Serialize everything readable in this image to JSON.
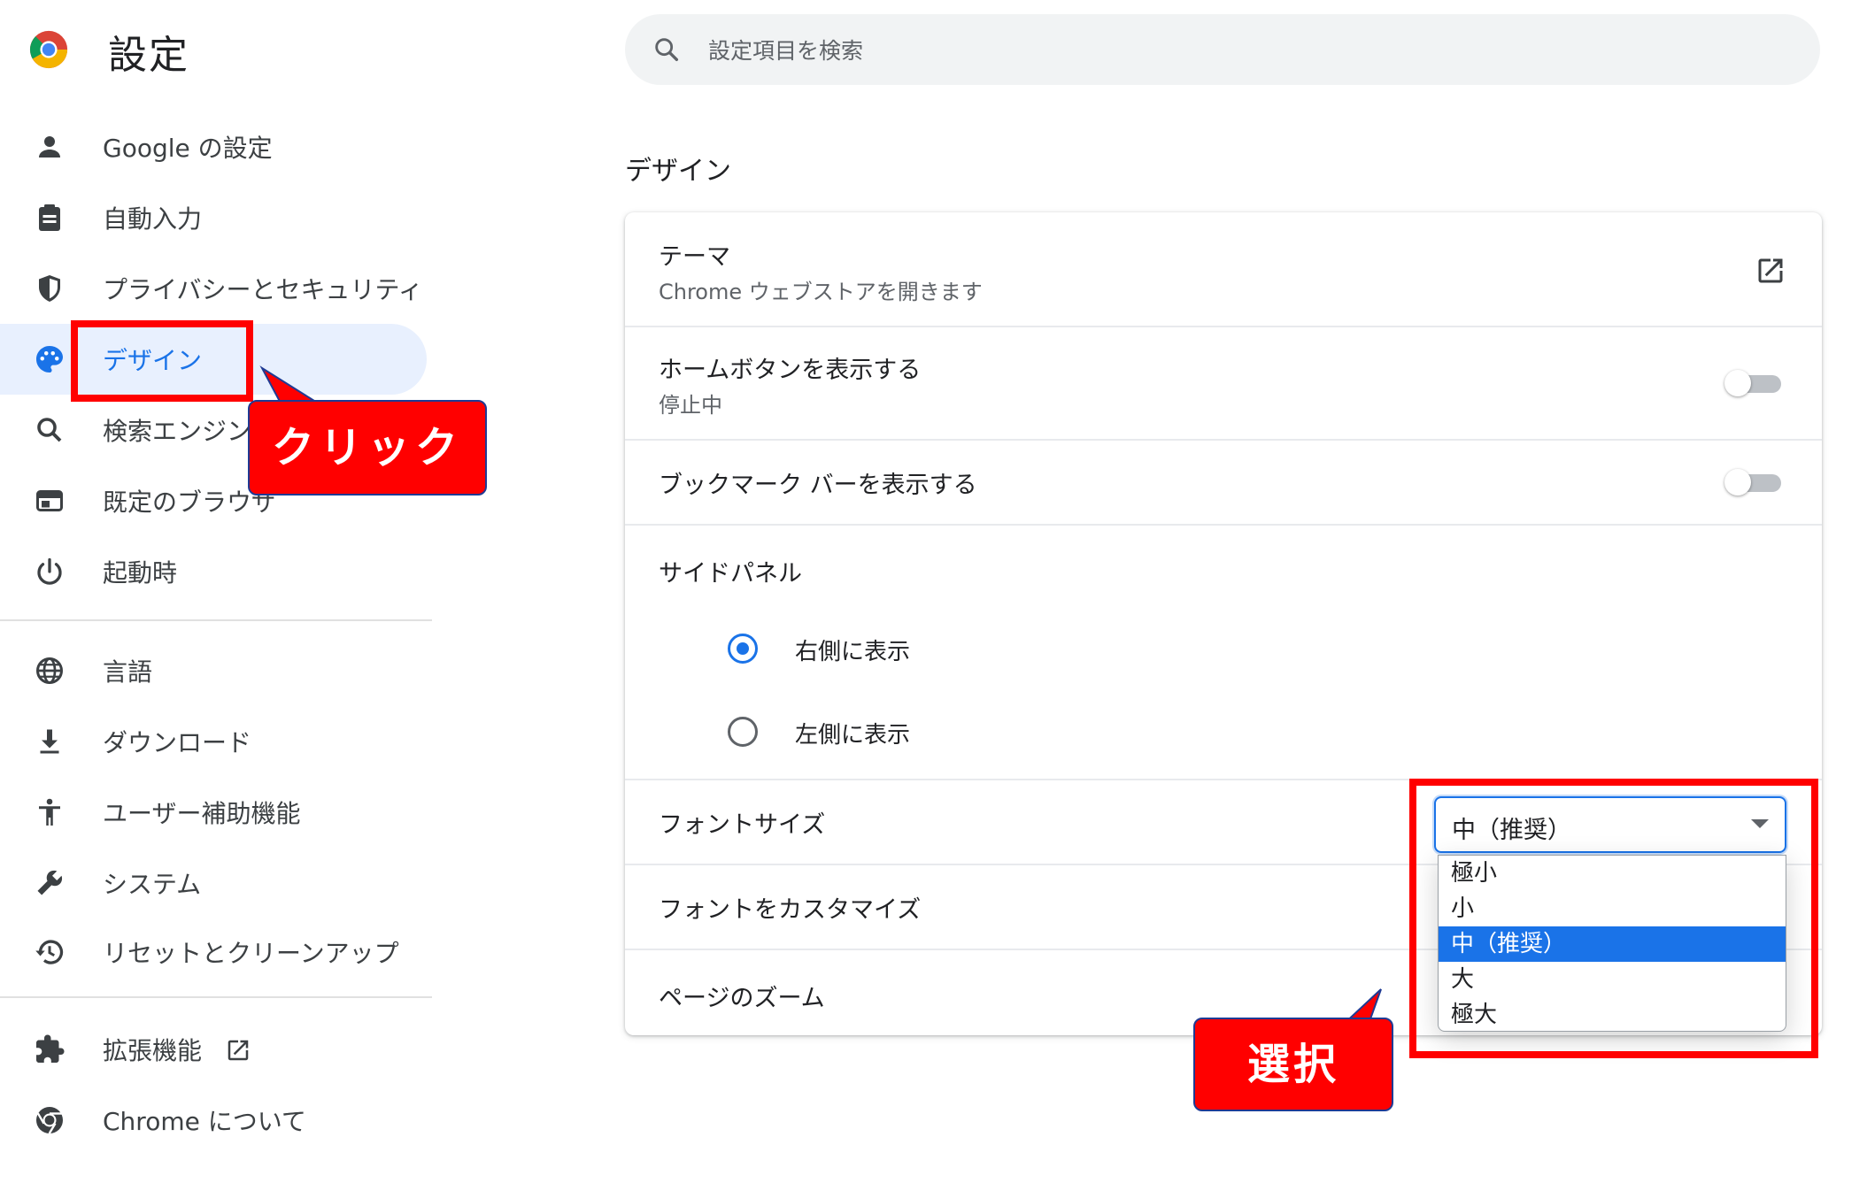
{
  "header": {
    "title": "設定",
    "search_placeholder": "設定項目を検索"
  },
  "sidebar": {
    "items": [
      {
        "label": "Google の設定",
        "icon": "person-icon"
      },
      {
        "label": "自動入力",
        "icon": "clipboard-icon"
      },
      {
        "label": "プライバシーとセキュリティ",
        "icon": "shield-icon"
      },
      {
        "label": "デザイン",
        "icon": "palette-icon",
        "active": true
      },
      {
        "label": "検索エンジン",
        "icon": "search-icon"
      },
      {
        "label": "既定のブラウザ",
        "icon": "browser-window-icon"
      },
      {
        "label": "起動時",
        "icon": "power-icon"
      },
      {
        "label": "言語",
        "icon": "globe-icon"
      },
      {
        "label": "ダウンロード",
        "icon": "download-icon"
      },
      {
        "label": "ユーザー補助機能",
        "icon": "accessibility-icon"
      },
      {
        "label": "システム",
        "icon": "wrench-icon"
      },
      {
        "label": "リセットとクリーンアップ",
        "icon": "restore-icon"
      },
      {
        "label": "拡張機能",
        "icon": "puzzle-icon"
      },
      {
        "label": "Chrome について",
        "icon": "chrome-icon"
      }
    ]
  },
  "main": {
    "section_title": "デザイン",
    "theme": {
      "title": "テーマ",
      "subtitle": "Chrome ウェブストアを開きます"
    },
    "home_button": {
      "title": "ホームボタンを表示する",
      "subtitle": "停止中",
      "enabled": false
    },
    "bookmarks_bar": {
      "title": "ブックマーク バーを表示する",
      "enabled": false
    },
    "side_panel": {
      "title": "サイドパネル",
      "options": [
        {
          "label": "右側に表示",
          "checked": true
        },
        {
          "label": "左側に表示",
          "checked": false
        }
      ]
    },
    "font_size": {
      "title": "フォントサイズ",
      "selected": "中（推奨）",
      "options": [
        "極小",
        "小",
        "中（推奨）",
        "大",
        "極大"
      ]
    },
    "customize_fonts": {
      "title": "フォントをカスタマイズ"
    },
    "page_zoom": {
      "title": "ページのズーム"
    }
  },
  "annotations": {
    "click_label": "クリック",
    "select_label": "選択"
  },
  "colors": {
    "accent": "#1a73e8",
    "active_nav_bg": "#e8f0fe",
    "annotation_red": "#ff0000"
  }
}
